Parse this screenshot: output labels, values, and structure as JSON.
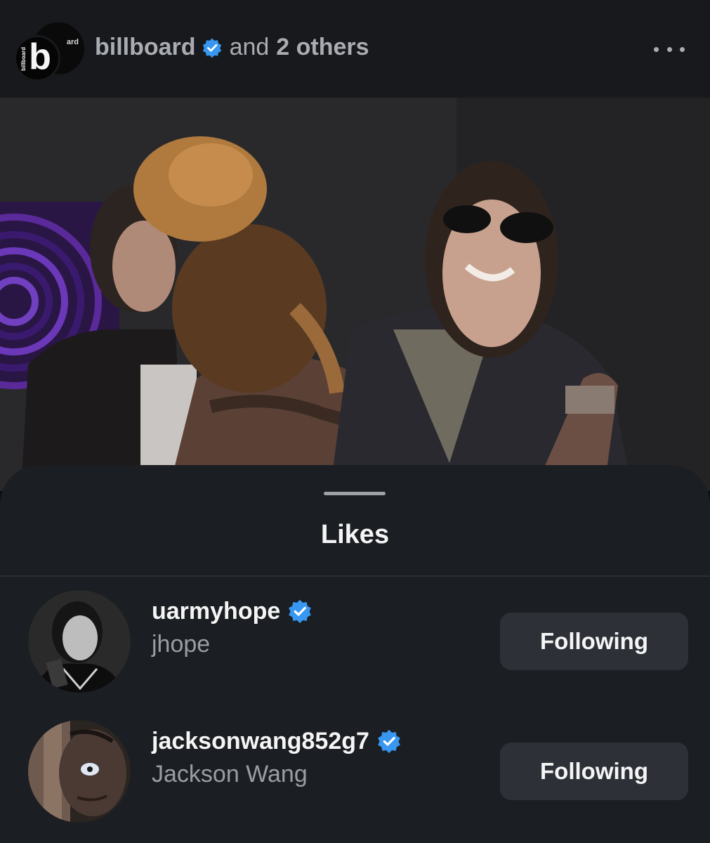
{
  "post_header": {
    "username": "billboard",
    "connector": "and",
    "others": "2 others",
    "avatar_label": "billboard",
    "avatar_back_label": "ard"
  },
  "post_image": {
    "description_icon": "post-photo"
  },
  "likes_sheet": {
    "title": "Likes",
    "rows": [
      {
        "handle": "uarmyhope",
        "name": "jhope",
        "verified": true,
        "button": "Following"
      },
      {
        "handle": "jacksonwang852g7",
        "name": "Jackson Wang",
        "verified": true,
        "button": "Following"
      }
    ]
  },
  "colors": {
    "verified": "#3897f0",
    "header_bg": "#17191d",
    "sheet_bg": "#1b1e22",
    "button_bg": "#2d3137"
  },
  "icons": {
    "verified": "verified-badge-icon",
    "more": "more-options-icon"
  }
}
